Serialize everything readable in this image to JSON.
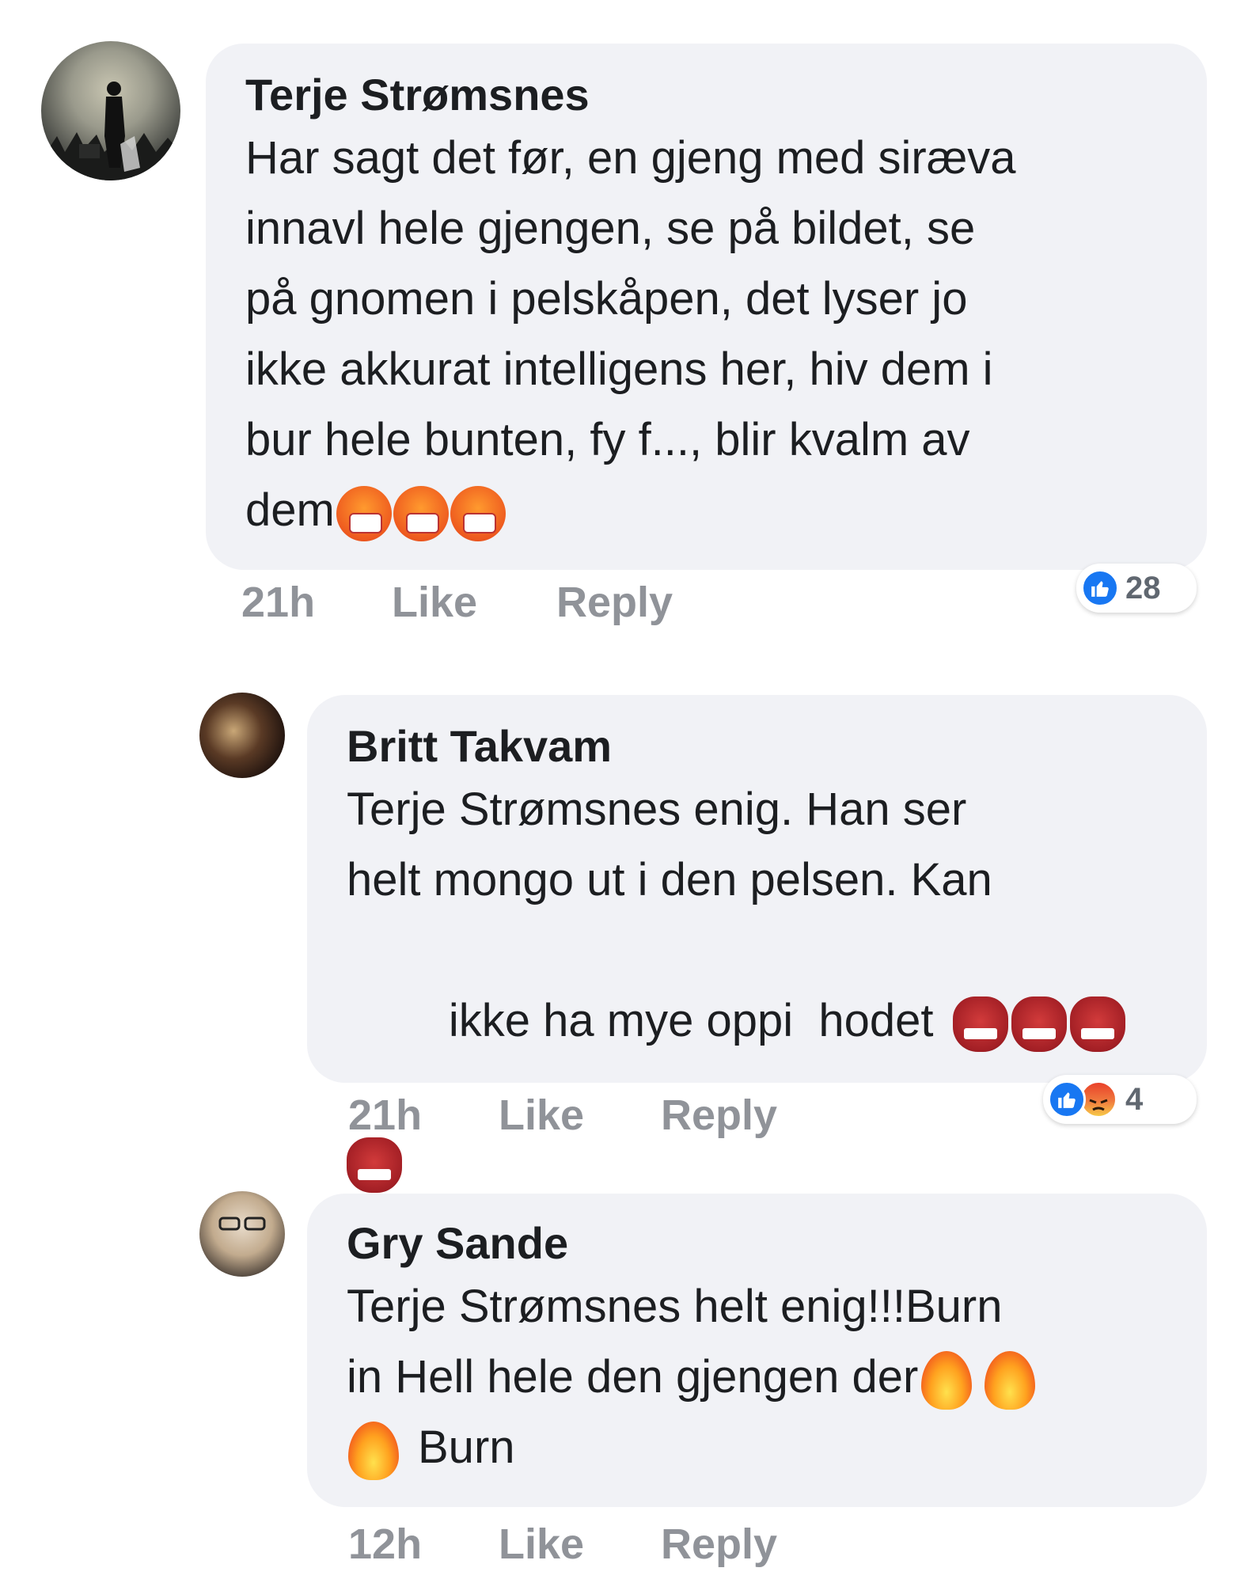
{
  "comments": [
    {
      "author": "Terje Strømsnes",
      "lines": [
        "Har sagt det før, en gjeng med siræva",
        "innavl hele gjengen, se på bildet, se",
        "på gnomen i pelskåpen, det lyser jo",
        "ikke akkurat intelligens her, hiv dem i",
        "bur hele bunten, fy f..., blir kvalm av",
        "dem"
      ],
      "emojis": [
        "face-with-mask",
        "face-with-mask",
        "face-with-mask"
      ],
      "time": "21h",
      "like_label": "Like",
      "reply_label": "Reply",
      "reaction_count": "28",
      "reactions": [
        "like"
      ]
    },
    {
      "author": "Britt Takvam",
      "lines": [
        "Terje Strømsnes enig. Han ser",
        "helt  mongo  ut i den pelsen. Kan",
        "ikke ha mye oppi  hodet"
      ],
      "emojis": [
        "ogre",
        "ogre",
        "ogre",
        "ogre"
      ],
      "time": "21h",
      "like_label": "Like",
      "reply_label": "Reply",
      "reaction_count": "4",
      "reactions": [
        "like",
        "angry"
      ]
    },
    {
      "author": "Gry Sande",
      "lines": [
        "Terje Strømsnes helt enig!!!Burn",
        "in Hell hele den gjengen der",
        "Burn"
      ],
      "emojis": [
        "fire",
        "fire",
        "fire"
      ],
      "time": "12h",
      "like_label": "Like",
      "reply_label": "Reply"
    }
  ],
  "colors": {
    "bubble": "#f1f2f6",
    "action_text": "#909399",
    "like_blue": "#1877f2"
  }
}
